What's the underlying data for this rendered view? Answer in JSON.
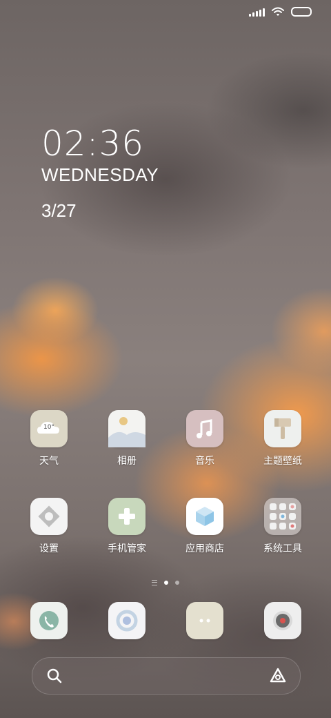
{
  "status_bar": {
    "icons": [
      "signal-icon",
      "wifi-icon",
      "battery-icon"
    ]
  },
  "clock": {
    "time": "02:36",
    "day": "WEDNESDAY",
    "date": "3/27"
  },
  "weather_widget": {
    "temp": "10°"
  },
  "apps": [
    {
      "label": "天气",
      "icon": "weather-icon"
    },
    {
      "label": "相册",
      "icon": "gallery-icon"
    },
    {
      "label": "音乐",
      "icon": "music-icon"
    },
    {
      "label": "主题壁纸",
      "icon": "theme-icon"
    },
    {
      "label": "设置",
      "icon": "settings-icon"
    },
    {
      "label": "手机管家",
      "icon": "security-icon"
    },
    {
      "label": "应用商店",
      "icon": "app-store-icon"
    },
    {
      "label": "系统工具",
      "icon": "folder-icon"
    }
  ],
  "page_indicator": {
    "pages": 2,
    "active": 1
  },
  "dock": [
    {
      "icon": "phone-icon"
    },
    {
      "icon": "browser-icon"
    },
    {
      "icon": "messages-icon"
    },
    {
      "icon": "camera-icon"
    }
  ],
  "search_bar": {
    "left_icon": "search-icon",
    "right_icon": "assistant-icon"
  },
  "colors": {
    "weather_bg": "#dcd7c6",
    "gallery_bg": "#f3f3f1",
    "music_bg": "#d6bfc0",
    "theme_bg": "#eef0ee",
    "settings_bg": "#f4f4f4",
    "security_bg": "#c8d8bc",
    "store_bg": "#ffffff",
    "folder_bg": "rgba(235,230,228,0.55)",
    "phone_bg": "#eef1ee",
    "browser_bg": "#f4f4f6",
    "messages_bg": "#e4e0cf",
    "camera_bg": "#eeeeee"
  }
}
